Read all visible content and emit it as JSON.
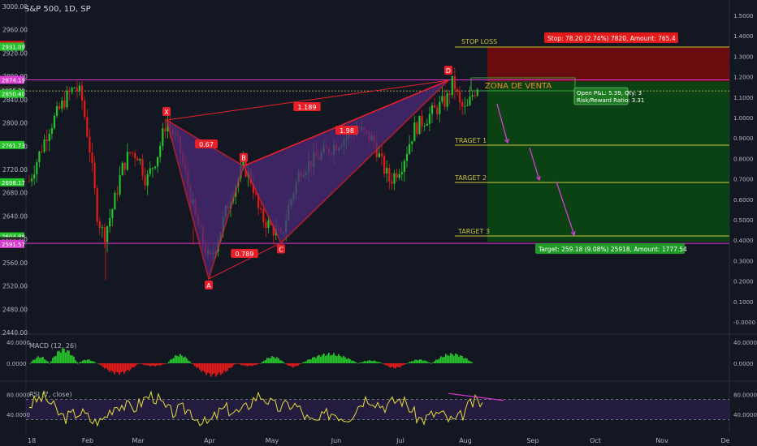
{
  "header": {
    "title": "S&P 500, 1D, SP"
  },
  "colors": {
    "background": "#131722",
    "bull": "#26c22b",
    "bear": "#e31a1a",
    "pattern": "#e8202a",
    "pattern_fill": "#4b2a7a",
    "magenta": "#e535d6",
    "yellow_line": "#c9c437",
    "stop_zone": "#7a0b0b",
    "target_zone": "#0b4a12",
    "rsi_line": "#e6dc3a",
    "arrow": "#d63fd0"
  },
  "chart_data": [
    {
      "type": "candlestick",
      "name": "price",
      "x_ticks": [
        "18",
        "Feb",
        "Mar",
        "Apr",
        "May",
        "Jun",
        "Jul",
        "Aug",
        "Sep",
        "Oct",
        "Nov",
        "De"
      ],
      "y_ticks": [
        "3000.00",
        "2960.00",
        "2920.00",
        "2880.00",
        "2840.00",
        "2800.00",
        "2760.00",
        "2720.00",
        "2680.00",
        "2640.00",
        "2600.00",
        "2560.00",
        "2520.00",
        "2480.00",
        "2440.00"
      ],
      "ylim": [
        2440,
        3000
      ],
      "price_labels": [
        {
          "text": "2933.99",
          "color": "#e31a1a"
        },
        {
          "text": "2931.09",
          "color": "#26c22b"
        },
        {
          "text": "2874.19",
          "color": "#d63fd0"
        },
        {
          "text": "2855.79",
          "color": "#2b2b2b"
        },
        {
          "text": "2850.40",
          "color": "#26c22b"
        },
        {
          "text": "2761.73",
          "color": "#26c22b"
        },
        {
          "text": "2698.17",
          "color": "#26c22b"
        },
        {
          "text": "2604.88",
          "color": "#26c22b"
        },
        {
          "text": "2596.61",
          "color": "#2b2b2b"
        },
        {
          "text": "2591.57",
          "color": "#d63fd0"
        }
      ],
      "right_axis_ticks": [
        "1.5000",
        "1.4000",
        "1.3000",
        "1.2000",
        "1.1000",
        "1.0000",
        "0.9000",
        "0.8000",
        "0.7000",
        "0.6000",
        "0.5000",
        "0.4000",
        "0.3000",
        "0.2000",
        "0.1000",
        "-0.0000"
      ],
      "harmonic_pattern": {
        "points": [
          {
            "label": "X",
            "value": 2805
          },
          {
            "label": "A",
            "value": 2532
          },
          {
            "label": "B",
            "value": 2726
          },
          {
            "label": "C",
            "value": 2594
          },
          {
            "label": "D",
            "value": 2873
          }
        ],
        "ratios": [
          "0.67",
          "0.789",
          "1.98",
          "1.189"
        ]
      },
      "annotations": {
        "stop_loss_label": "STOP LOSS",
        "stop_box": "Stop: 78.20 (2.74%) 7820, Amount: 765.4",
        "zona": "ZONA DE VENTA",
        "pnl_line1": "Open P&L: 5.39, Qty: 3",
        "pnl_line2": "Risk/Reward Ratio: 3.31",
        "target1": "TRAGET 1",
        "target2": "TARGET 2",
        "target3": "TARGET 3",
        "target_box": "Target: 259.18 (9.08%) 25918, Amount: 1777.54"
      }
    },
    {
      "type": "histogram",
      "name": "macd",
      "label": "MACD (12, 26)",
      "y_ticks": [
        "40.0000",
        "0.0000"
      ],
      "right_ticks": [
        "40.0000",
        "0.0000"
      ],
      "ylim": [
        -30,
        45
      ]
    },
    {
      "type": "line",
      "name": "rsi",
      "label": "RSI (7, close)",
      "y_ticks": [
        "80.0000",
        "40.0000"
      ],
      "right_ticks": [
        "80.0000",
        "40.0000"
      ],
      "ylim": [
        0,
        100
      ],
      "bands": [
        70,
        30
      ]
    }
  ]
}
